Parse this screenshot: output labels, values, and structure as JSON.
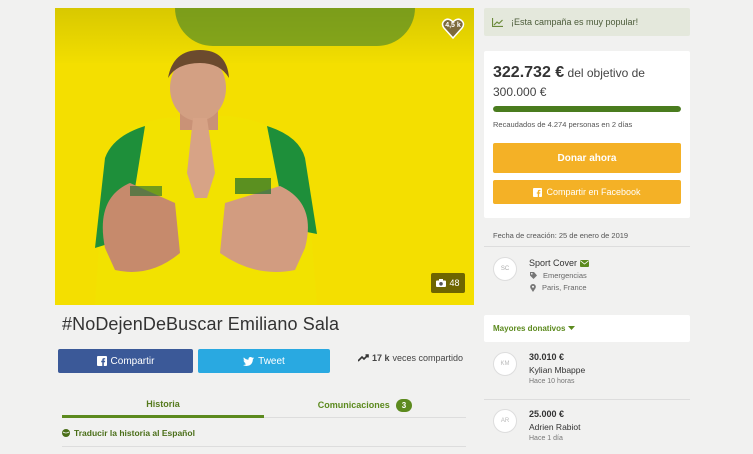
{
  "hero": {
    "heart_count": "4,5 k",
    "photo_count": "48"
  },
  "campaign": {
    "title": "#NoDejenDeBuscar Emiliano Sala"
  },
  "share": {
    "facebook_label": "Compartir",
    "twitter_label": "Tweet",
    "count_number": "17 k",
    "count_suffix": "veces compartido"
  },
  "tabs": [
    {
      "label": "Historia"
    },
    {
      "label": "Comunicaciones",
      "count": "3"
    }
  ],
  "translate_label": "Traducir la historia al Español",
  "sidebar": {
    "popular_text": "¡Esta campaña es muy popular!",
    "raised_amount": "322.732 €",
    "raised_goal_text": "del objetivo de 300.000 €",
    "progress_fraction": 1.0,
    "donors_info": "Recaudados de 4.274 personas en 2 días",
    "donate_button": "Donar ahora",
    "share_facebook_button": "Compartir en Facebook",
    "created_text": "Fecha de creación: 25 de enero de 2019",
    "organizer": {
      "avatar_initials": "SC",
      "name": "Sport Cover",
      "category": "Emergencias",
      "location": "Paris, France"
    },
    "donations_header": "Mayores donativos",
    "donations": [
      {
        "initials": "KM",
        "amount": "30.010 €",
        "name": "Kylian Mbappe",
        "time": "Hace 10 horas"
      },
      {
        "initials": "AR",
        "amount": "25.000 €",
        "name": "Adrien Rabiot",
        "time": "Hace 1 día"
      }
    ]
  },
  "colors": {
    "accent_green": "#5c8a1e",
    "donate_orange": "#f4b126",
    "facebook_blue": "#3b5998",
    "twitter_blue": "#29a9e1",
    "hero_yellow": "#f4df00"
  }
}
